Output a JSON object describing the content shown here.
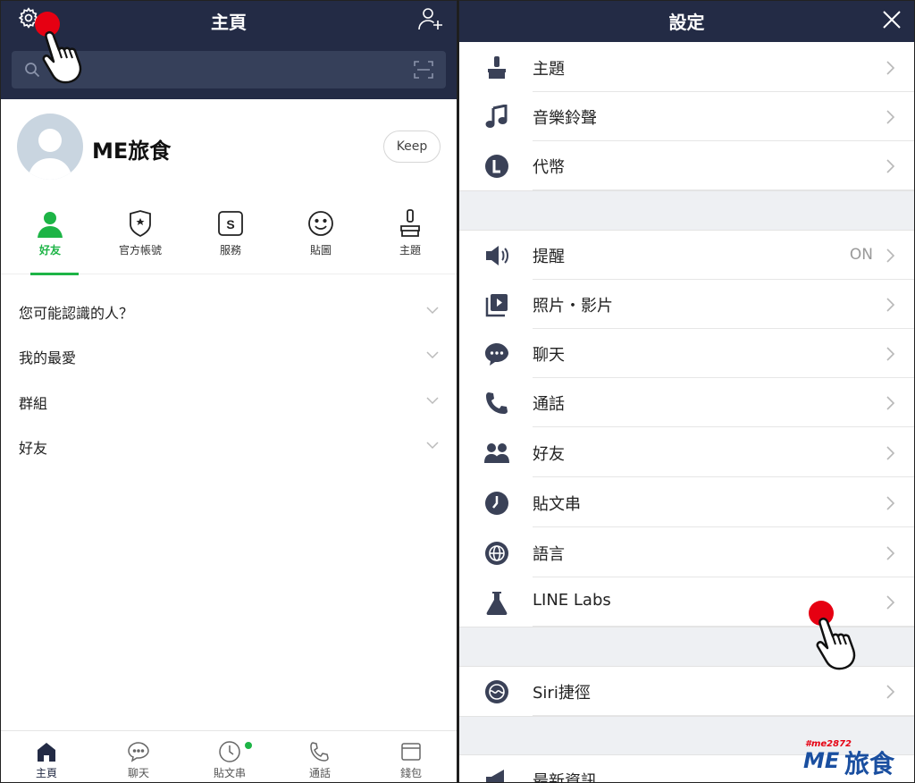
{
  "home": {
    "title": "主頁",
    "search_value": "",
    "profile_name": "ME旅食",
    "keep_label": "Keep",
    "tabs": [
      {
        "label": "好友",
        "icon": "person-icon",
        "active": true
      },
      {
        "label": "官方帳號",
        "icon": "official-shield-icon"
      },
      {
        "label": "服務",
        "icon": "services-icon"
      },
      {
        "label": "貼圖",
        "icon": "smiley-icon"
      },
      {
        "label": "主題",
        "icon": "paintbrush-icon"
      }
    ],
    "sections": [
      {
        "label": "您可能認識的人？"
      },
      {
        "label": "我的最愛"
      },
      {
        "label": "群組"
      },
      {
        "label": "好友"
      }
    ],
    "bottom_nav": [
      {
        "label": "主頁",
        "icon": "home-icon",
        "active": true
      },
      {
        "label": "聊天",
        "icon": "chat-icon"
      },
      {
        "label": "貼文串",
        "icon": "clock-icon",
        "badge": true
      },
      {
        "label": "通話",
        "icon": "phone-icon"
      },
      {
        "label": "錢包",
        "icon": "wallet-icon"
      }
    ]
  },
  "settings": {
    "title": "設定",
    "groups": [
      [
        {
          "label": "主題",
          "icon": "paintbrush-icon"
        },
        {
          "label": "音樂鈴聲",
          "icon": "music-note-icon"
        },
        {
          "label": "代幣",
          "icon": "coin-icon"
        }
      ],
      [
        {
          "label": "提醒",
          "icon": "speaker-icon",
          "value": "ON"
        },
        {
          "label": "照片・影片",
          "icon": "photo-video-icon"
        },
        {
          "label": "聊天",
          "icon": "chat-bubble-icon"
        },
        {
          "label": "通話",
          "icon": "phone-icon"
        },
        {
          "label": "好友",
          "icon": "friends-icon"
        },
        {
          "label": "貼文串",
          "icon": "clock-icon"
        },
        {
          "label": "語言",
          "icon": "globe-icon"
        },
        {
          "label": "LINE Labs",
          "icon": "flask-icon"
        }
      ],
      [
        {
          "label": "Siri捷徑",
          "icon": "siri-icon"
        }
      ],
      [
        {
          "label": "最新資訊",
          "icon": "megaphone-icon"
        }
      ]
    ]
  },
  "watermark": {
    "tag": "#me2872",
    "brand_latin": "ME",
    "brand_cn": "旅食"
  },
  "colors": {
    "navy": "#232b45",
    "green": "#1db446",
    "tap_red": "#e60012"
  }
}
